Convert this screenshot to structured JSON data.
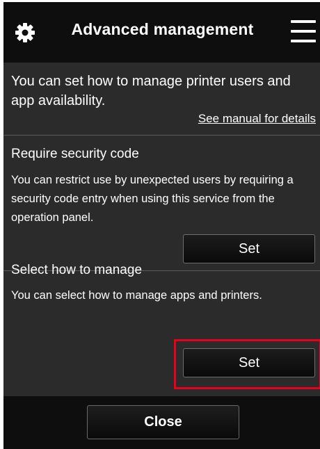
{
  "header": {
    "title": "Advanced management",
    "settings_icon": "gear-icon",
    "menu_icon": "hamburger-menu-icon"
  },
  "intro": {
    "text": "You can set how to manage printer users and app availability.",
    "manual_link": "See manual for details"
  },
  "sections": [
    {
      "title": "Require security code",
      "description": "You can restrict use by unexpected users by requiring a security code entry when using this service from the operation panel.",
      "button_label": "Set"
    },
    {
      "title": "Select how to manage",
      "description": "You can select how to manage apps and printers.",
      "button_label": "Set"
    }
  ],
  "footer": {
    "close_label": "Close"
  },
  "colors": {
    "background": "#2b2b2b",
    "bar": "#0e0e0e",
    "highlight": "#e8001c"
  }
}
